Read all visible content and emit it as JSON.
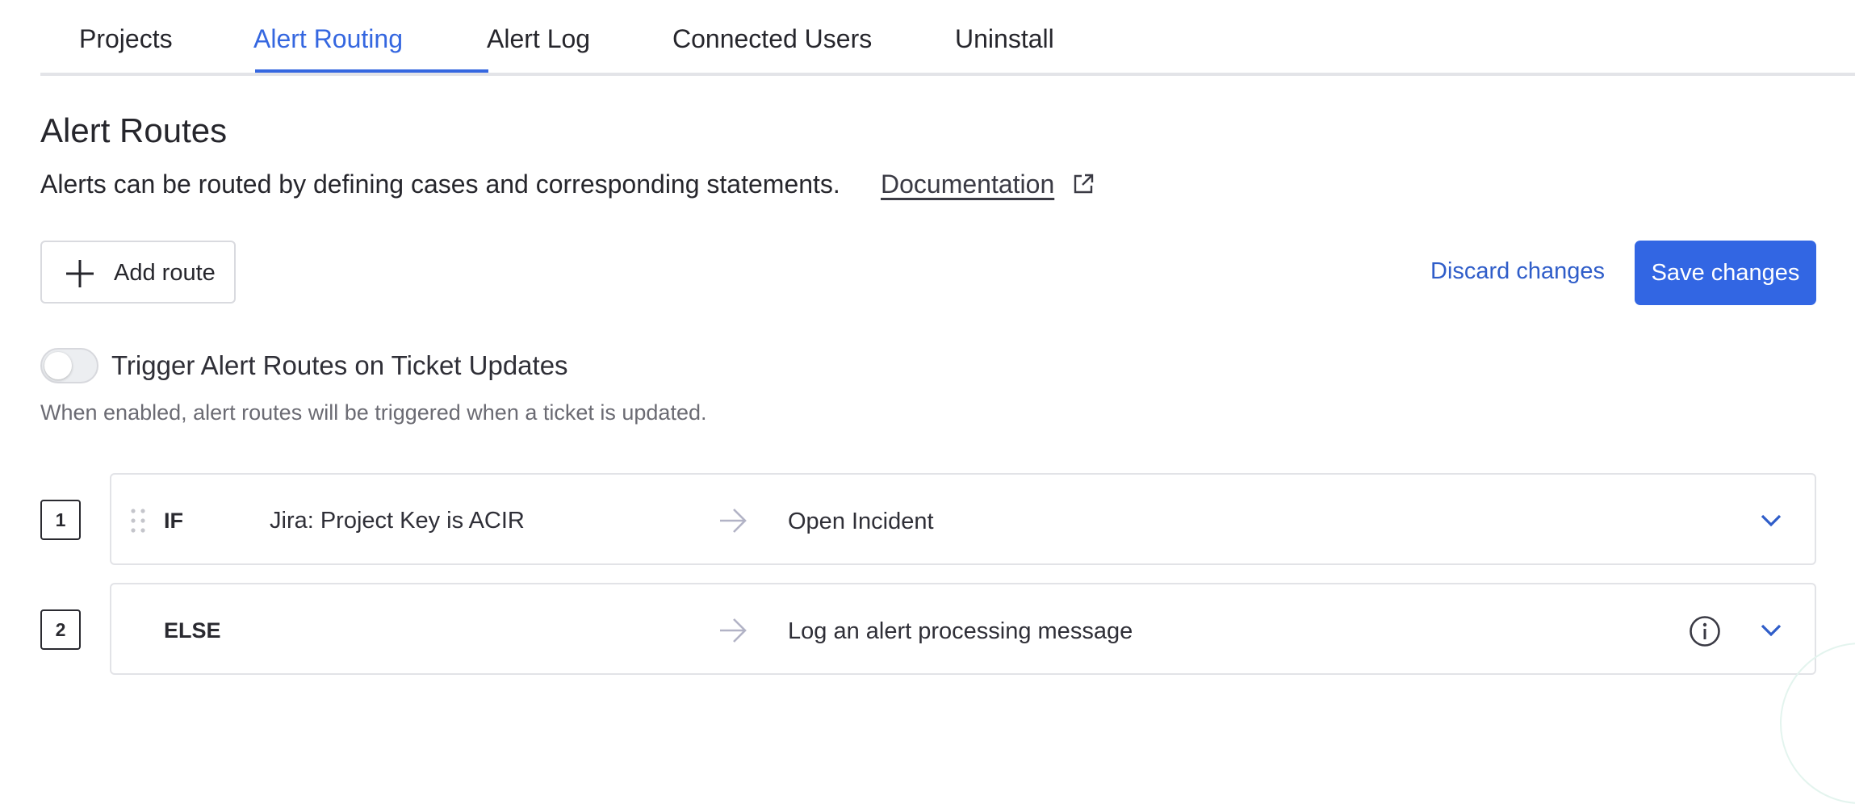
{
  "tabs": [
    {
      "label": "Projects",
      "active": false
    },
    {
      "label": "Alert Routing",
      "active": true
    },
    {
      "label": "Alert Log",
      "active": false
    },
    {
      "label": "Connected Users",
      "active": false
    },
    {
      "label": "Uninstall",
      "active": false
    }
  ],
  "section": {
    "title": "Alert Routes",
    "description": "Alerts can be routed by defining cases and corresponding statements.",
    "doc_link": "Documentation"
  },
  "toolbar": {
    "add_route_label": "Add route",
    "discard_label": "Discard changes",
    "save_label": "Save changes"
  },
  "toggle": {
    "label": "Trigger Alert Routes on Ticket Updates",
    "help": "When enabled, alert routes will be triggered when a ticket is updated.",
    "enabled": false
  },
  "routes": [
    {
      "number": "1",
      "keyword": "IF",
      "condition": "Jira: Project Key is ACIR",
      "action": "Open Incident"
    },
    {
      "number": "2",
      "keyword": "ELSE",
      "condition": "",
      "action": "Log an alert processing message"
    }
  ],
  "colors": {
    "accent": "#3567e0",
    "primary_button": "#3266e3",
    "link": "#2f5dc9",
    "border": "#e2e3e7"
  },
  "icons": {
    "doc_link": "external-link-icon",
    "add": "plus-icon",
    "drag": "drag-handle-icon",
    "flow": "arrow-right-icon",
    "info": "info-icon",
    "expand": "chevron-down-icon"
  }
}
